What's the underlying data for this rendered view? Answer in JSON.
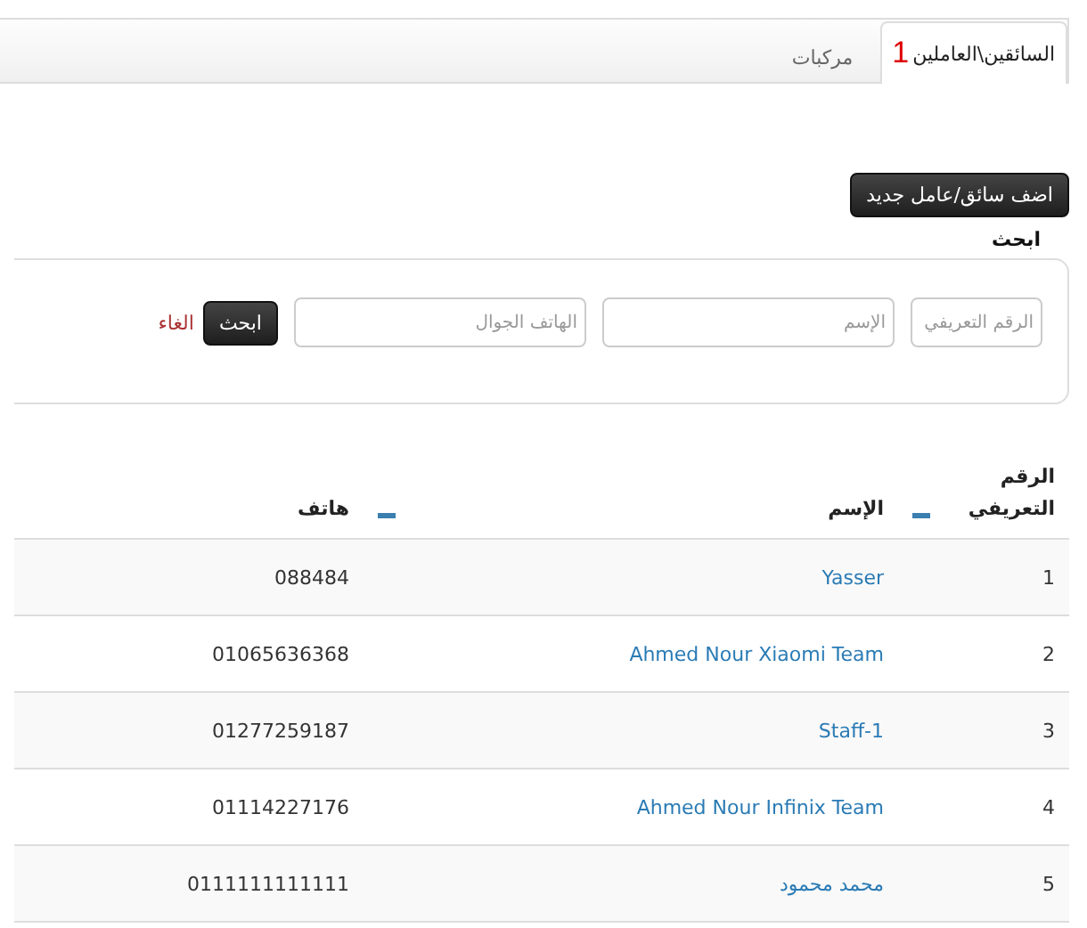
{
  "tabs": [
    {
      "label": "السائقين\\العاملين",
      "badge": "1",
      "selected": true
    },
    {
      "label": "مركبات",
      "selected": false
    }
  ],
  "add_button": "اضف سائق/عامل جديد",
  "search": {
    "title": "ابحث",
    "fields": [
      {
        "placeholder": "الرقم التعريفي"
      },
      {
        "placeholder": "الإسم"
      },
      {
        "placeholder": "الهاتف الجوال"
      }
    ],
    "submit": "ابحث",
    "cancel": "الغاء"
  },
  "table": {
    "columns": [
      {
        "label": "الرقم التعريفي",
        "sortable": true
      },
      {
        "label": "الإسم",
        "sortable": true
      },
      {
        "label": "هاتف",
        "sortable": false
      }
    ],
    "rows": [
      {
        "id": "1",
        "name": "Yasser",
        "phone": "088484"
      },
      {
        "id": "2",
        "name": "Ahmed Nour Xiaomi Team",
        "phone": "01065636368"
      },
      {
        "id": "3",
        "name": "Staff-1",
        "phone": "01277259187"
      },
      {
        "id": "4",
        "name": "Ahmed Nour Infinix Team",
        "phone": "01114227176"
      },
      {
        "id": "5",
        "name": "محمد محمود",
        "phone": "0111111111111"
      }
    ]
  }
}
